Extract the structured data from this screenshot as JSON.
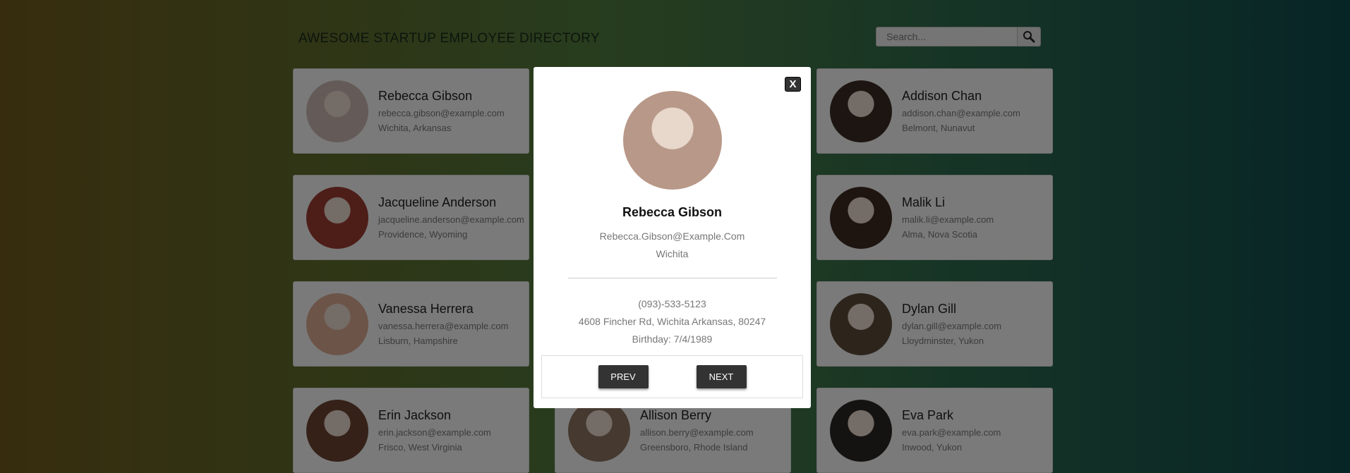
{
  "header": {
    "title": "AWESOME STARTUP EMPLOYEE DIRECTORY",
    "search_placeholder": "Search...",
    "search_icon": "search-icon"
  },
  "employees": [
    {
      "name": "Rebecca Gibson",
      "email": "rebecca.gibson@example.com",
      "location": "Wichita, Arkansas",
      "avatar_color": "#c8b6b0"
    },
    {
      "name": "",
      "email": "",
      "location": "",
      "avatar_color": "#cccccc"
    },
    {
      "name": "Addison Chan",
      "email": "addison.chan@example.com",
      "location": "Belmont, Nunavut",
      "avatar_color": "#3a2a22"
    },
    {
      "name": "Jacqueline Anderson",
      "email": "jacqueline.anderson@example.com",
      "location": "Providence, Wyoming",
      "avatar_color": "#9a3a30"
    },
    {
      "name": "",
      "email": "",
      "location": "",
      "avatar_color": "#cccccc"
    },
    {
      "name": "Malik Li",
      "email": "malik.li@example.com",
      "location": "Alma, Nova Scotia",
      "avatar_color": "#3e2a20"
    },
    {
      "name": "Vanessa Herrera",
      "email": "vanessa.herrera@example.com",
      "location": "Lisburn, Hampshire",
      "avatar_color": "#d9a890"
    },
    {
      "name": "",
      "email": "",
      "location": "",
      "avatar_color": "#cccccc"
    },
    {
      "name": "Dylan Gill",
      "email": "dylan.gill@example.com",
      "location": "Lloydminster, Yukon",
      "avatar_color": "#5a4a38"
    },
    {
      "name": "Erin Jackson",
      "email": "erin.jackson@example.com",
      "location": "Frisco, West Virginia",
      "avatar_color": "#6a4330"
    },
    {
      "name": "Allison Berry",
      "email": "allison.berry@example.com",
      "location": "Greensboro, Rhode Island",
      "avatar_color": "#8a7260"
    },
    {
      "name": "Eva Park",
      "email": "eva.park@example.com",
      "location": "Inwood, Yukon",
      "avatar_color": "#2a2624"
    }
  ],
  "modal": {
    "close_label": "X",
    "name": "Rebecca Gibson",
    "email": "Rebecca.Gibson@Example.Com",
    "city": "Wichita",
    "phone": "(093)-533-5123",
    "address": "4608 Fincher Rd, Wichita Arkansas, 80247",
    "birthday": "Birthday: 7/4/1989",
    "prev_label": "PREV",
    "next_label": "NEXT",
    "avatar_color": "#b89888"
  }
}
